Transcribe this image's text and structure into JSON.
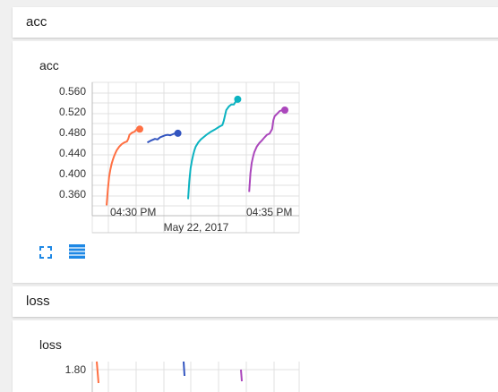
{
  "sections": [
    {
      "header": "acc",
      "card_title": "acc",
      "date_label": "May 22, 2017"
    },
    {
      "header": "loss",
      "card_title": "loss"
    }
  ],
  "controls": {
    "expand_icon": "expand-icon",
    "data_icon": "data-table-icon"
  },
  "colors": {
    "run1": "#ff7043",
    "run2": "#3355c0",
    "run3": "#0cb3c1",
    "run4": "#ab47bc",
    "grid": "#dedede",
    "icon": "#1e88e5"
  },
  "chart_data": [
    {
      "type": "line",
      "title": "acc",
      "x_ticks": [
        "04:30 PM",
        "04:35 PM"
      ],
      "x_date_label": "May 22, 2017",
      "ylim": [
        0.34,
        0.57
      ],
      "y_ticks": [
        "0.560",
        "0.520",
        "0.480",
        "0.440",
        "0.400",
        "0.360"
      ],
      "y_tick_values": [
        0.56,
        0.52,
        0.48,
        0.44,
        0.4,
        0.36
      ],
      "grid": true,
      "series": [
        {
          "color": "#ff7043",
          "points": [
            [
              0,
              0.342
            ],
            [
              1,
              0.372
            ],
            [
              2,
              0.397
            ],
            [
              3,
              0.412
            ],
            [
              4,
              0.423
            ],
            [
              5,
              0.431
            ],
            [
              6,
              0.438
            ],
            [
              7,
              0.444
            ],
            [
              8,
              0.449
            ],
            [
              10,
              0.456
            ],
            [
              12,
              0.461
            ],
            [
              14,
              0.464
            ],
            [
              16,
              0.466
            ],
            [
              17,
              0.471
            ],
            [
              18,
              0.479
            ],
            [
              20,
              0.483
            ],
            [
              22,
              0.485
            ],
            [
              23,
              0.488
            ],
            [
              24,
              0.49
            ],
            [
              26,
              0.49
            ]
          ]
        },
        {
          "color": "#3355c0",
          "points": [
            [
              32,
              0.464
            ],
            [
              35,
              0.468
            ],
            [
              38,
              0.471
            ],
            [
              40,
              0.47
            ],
            [
              42,
              0.474
            ],
            [
              44,
              0.476
            ],
            [
              46,
              0.478
            ],
            [
              48,
              0.479
            ],
            [
              50,
              0.478
            ],
            [
              52,
              0.48
            ],
            [
              54,
              0.482
            ],
            [
              56,
              0.482
            ]
          ]
        },
        {
          "color": "#0cb3c1",
          "points": [
            [
              64,
              0.354
            ],
            [
              65,
              0.39
            ],
            [
              66,
              0.414
            ],
            [
              67,
              0.428
            ],
            [
              68,
              0.44
            ],
            [
              69,
              0.449
            ],
            [
              70,
              0.456
            ],
            [
              72,
              0.464
            ],
            [
              74,
              0.47
            ],
            [
              76,
              0.474
            ],
            [
              79,
              0.48
            ],
            [
              82,
              0.485
            ],
            [
              85,
              0.489
            ],
            [
              88,
              0.494
            ],
            [
              91,
              0.498
            ],
            [
              92,
              0.506
            ],
            [
              94,
              0.527
            ],
            [
              96,
              0.534
            ],
            [
              98,
              0.538
            ],
            [
              100,
              0.538
            ],
            [
              102,
              0.546
            ],
            [
              103,
              0.548
            ]
          ]
        },
        {
          "color": "#ab47bc",
          "points": [
            [
              112,
              0.368
            ],
            [
              113,
              0.404
            ],
            [
              114,
              0.424
            ],
            [
              115,
              0.436
            ],
            [
              116,
              0.445
            ],
            [
              118,
              0.456
            ],
            [
              120,
              0.463
            ],
            [
              122,
              0.468
            ],
            [
              124,
              0.474
            ],
            [
              126,
              0.479
            ],
            [
              128,
              0.481
            ],
            [
              130,
              0.49
            ],
            [
              131,
              0.507
            ],
            [
              132,
              0.515
            ],
            [
              134,
              0.52
            ],
            [
              136,
              0.525
            ],
            [
              138,
              0.527
            ],
            [
              140,
              0.527
            ]
          ]
        }
      ]
    },
    {
      "type": "line",
      "title": "loss",
      "y_ticks": [
        "1.80"
      ],
      "y_tick_values": [
        1.8
      ],
      "grid": true,
      "series": []
    }
  ]
}
